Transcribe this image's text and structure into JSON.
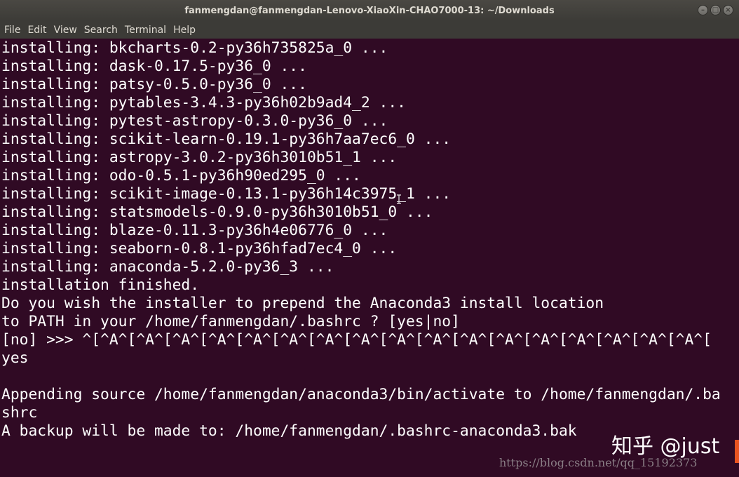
{
  "window": {
    "title": "fanmengdan@fanmengdan-Lenovo-XiaoXin-CHAO7000-13: ~/Downloads",
    "controls": [
      "minimize-icon",
      "maximize-icon",
      "close-icon"
    ]
  },
  "menu": [
    "File",
    "Edit",
    "View",
    "Search",
    "Terminal",
    "Help"
  ],
  "terminal": {
    "lines": [
      "installing: bkcharts-0.2-py36h735825a_0 ...",
      "installing: dask-0.17.5-py36_0 ...",
      "installing: patsy-0.5.0-py36_0 ...",
      "installing: pytables-3.4.3-py36h02b9ad4_2 ...",
      "installing: pytest-astropy-0.3.0-py36_0 ...",
      "installing: scikit-learn-0.19.1-py36h7aa7ec6_0 ...",
      "installing: astropy-3.0.2-py36h3010b51_1 ...",
      "installing: odo-0.5.1-py36h90ed295_0 ...",
      "installing: scikit-image-0.13.1-py36h14c3975_1 ...",
      "installing: statsmodels-0.9.0-py36h3010b51_0 ...",
      "installing: blaze-0.11.3-py36h4e06776_0 ...",
      "installing: seaborn-0.8.1-py36hfad7ec4_0 ...",
      "installing: anaconda-5.2.0-py36_3 ...",
      "installation finished.",
      "Do you wish the installer to prepend the Anaconda3 install location",
      "to PATH in your /home/fanmengdan/.bashrc ? [yes|no]",
      "[no] >>> ^[^A^[^A^[^A^[^A^[^A^[^A^[^A^[^A^[^A^[^A^[^A^[^A^[^A^[^A^[^A^[^A^[^A^[",
      "yes",
      "",
      "Appending source /home/fanmengdan/anaconda3/bin/activate to /home/fanmengdan/.ba",
      "shrc",
      "A backup will be made to: /home/fanmengdan/.bashrc-anaconda3.bak"
    ]
  },
  "watermark": {
    "text": "知乎 @just",
    "url": "https://blog.csdn.net/qq_15192373"
  }
}
